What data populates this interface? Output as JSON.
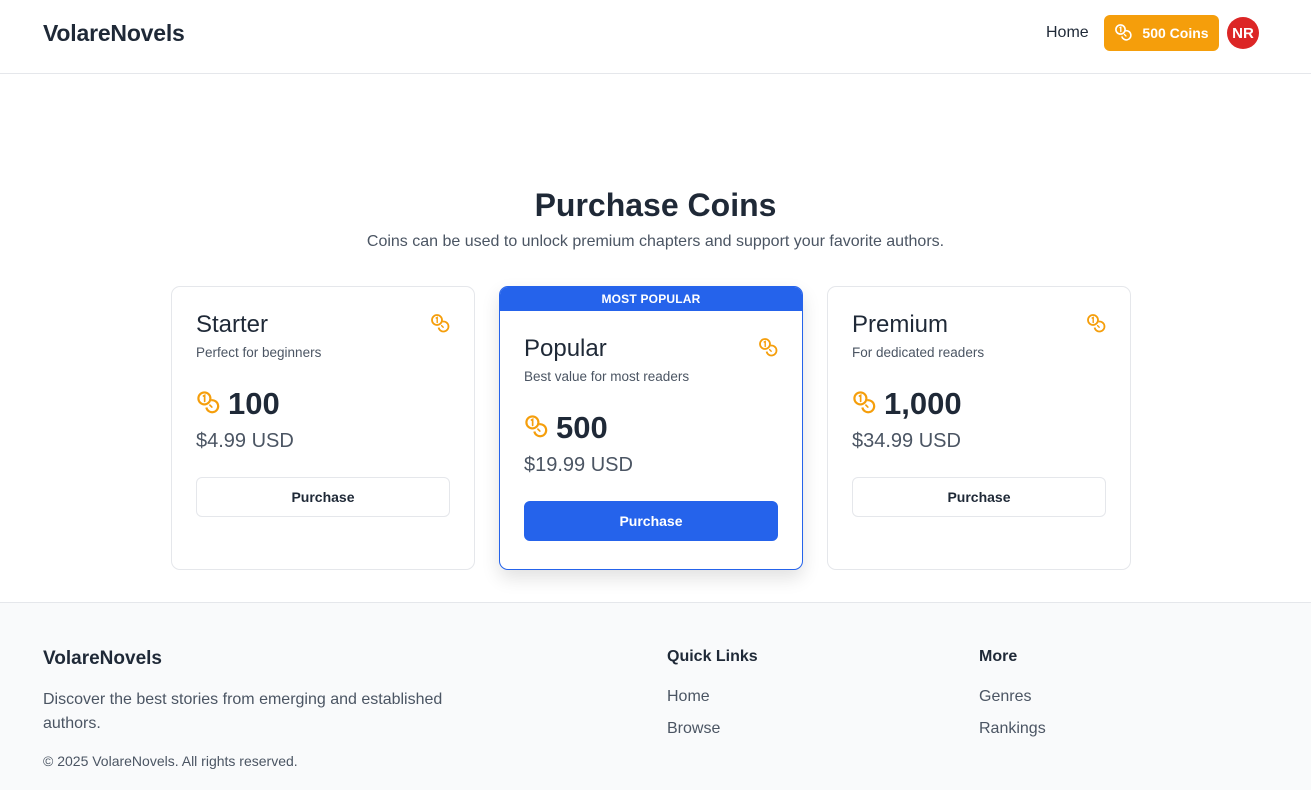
{
  "header": {
    "brand": "VolareNovels",
    "nav_home": "Home",
    "coins_label": "500 Coins",
    "avatar_initials": "NR"
  },
  "main": {
    "title": "Purchase Coins",
    "subtitle": "Coins can be used to unlock premium chapters and support your favorite authors.",
    "plans": [
      {
        "name": "Starter",
        "description": "Perfect for beginners",
        "coins": "100",
        "price": "$4.99 USD",
        "button": "Purchase"
      },
      {
        "name": "Popular",
        "description": "Best value for most readers",
        "coins": "500",
        "price": "$19.99 USD",
        "button": "Purchase",
        "badge": "MOST POPULAR"
      },
      {
        "name": "Premium",
        "description": "For dedicated readers",
        "coins": "1,000",
        "price": "$34.99 USD",
        "button": "Purchase"
      }
    ]
  },
  "footer": {
    "brand": "VolareNovels",
    "description": "Discover the best stories from emerging and established authors.",
    "copyright": "© 2025 VolareNovels. All rights reserved.",
    "quick_links": {
      "title": "Quick Links",
      "items": [
        "Home",
        "Browse"
      ]
    },
    "more": {
      "title": "More",
      "items": [
        "Genres",
        "Rankings"
      ]
    }
  },
  "colors": {
    "accent_blue": "#2563eb",
    "coin_orange": "#f59e0b",
    "avatar_red": "#dc2626"
  },
  "icons": {
    "coin": "coins-icon"
  }
}
